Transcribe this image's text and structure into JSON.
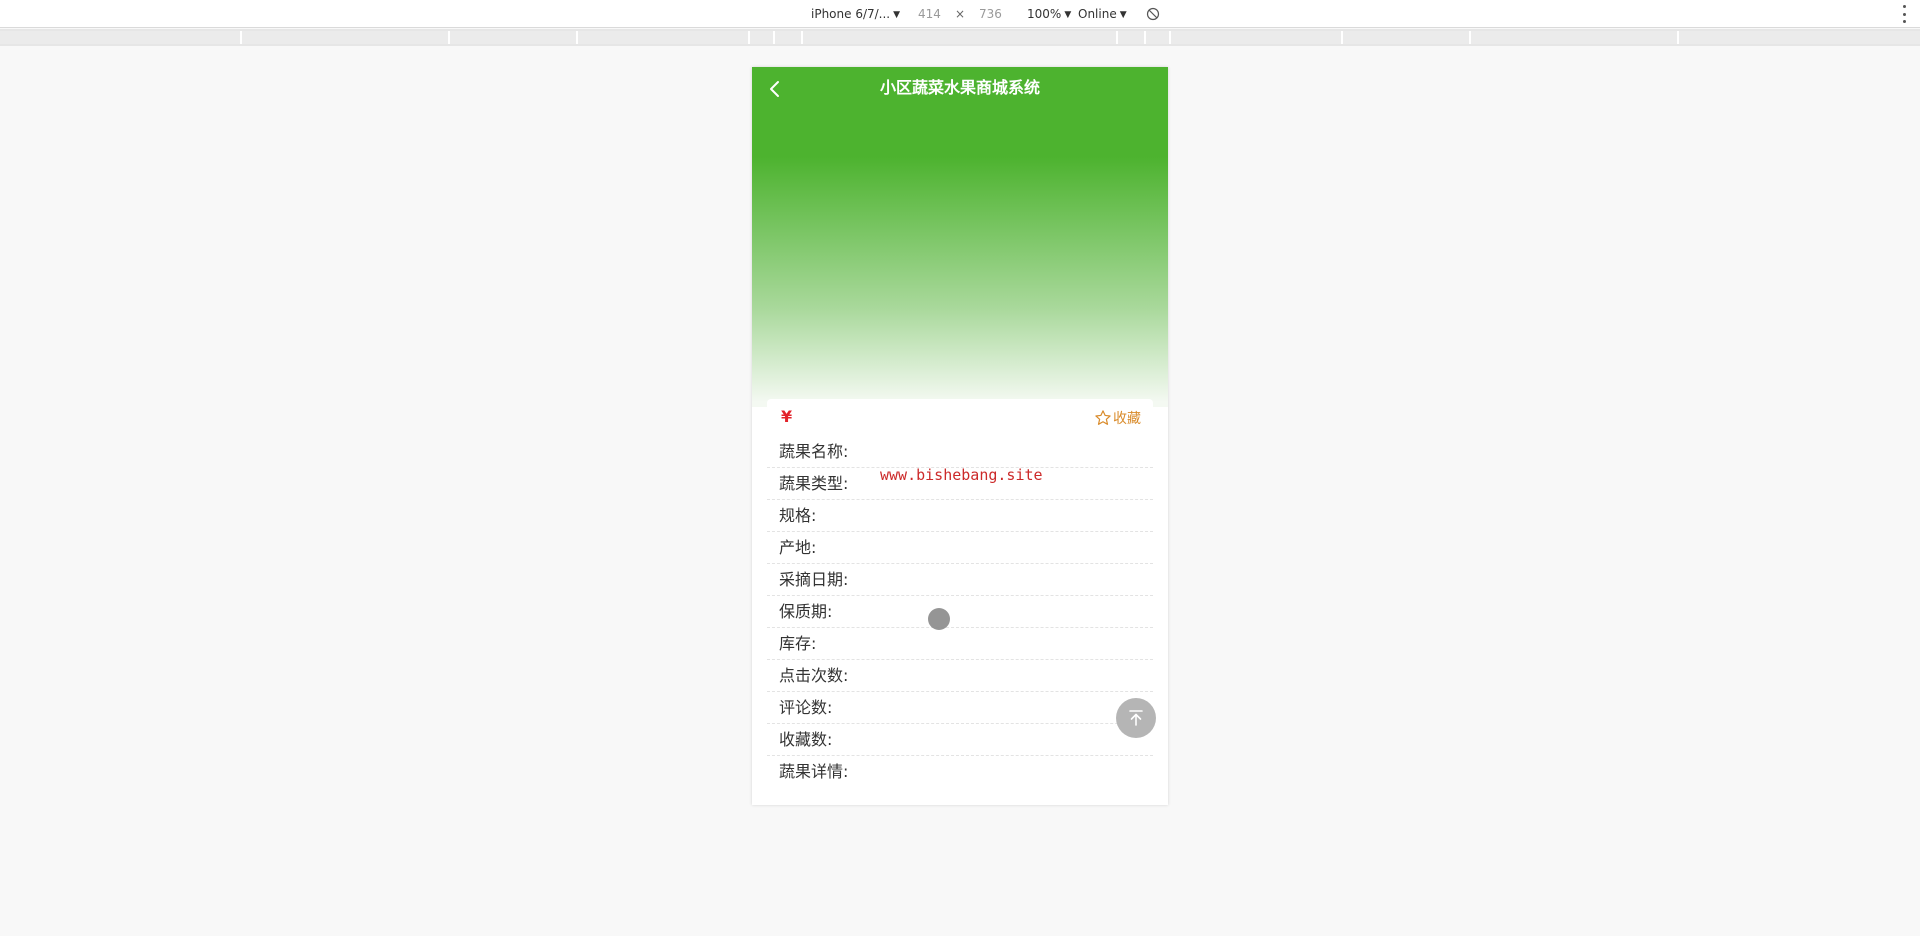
{
  "devtools": {
    "device": "iPhone 6/7/...",
    "width": "414",
    "times": "×",
    "height": "736",
    "zoom": "100%",
    "network": "Online"
  },
  "app": {
    "title": "小区蔬菜水果商城系统"
  },
  "product": {
    "currency": "¥",
    "favorite_label": "收藏",
    "fields": [
      {
        "label": "蔬果名称:"
      },
      {
        "label": "蔬果类型:"
      },
      {
        "label": "规格:"
      },
      {
        "label": "产地:"
      },
      {
        "label": "采摘日期:"
      },
      {
        "label": "保质期:"
      },
      {
        "label": "库存:"
      },
      {
        "label": "点击次数:"
      },
      {
        "label": "评论数:"
      },
      {
        "label": "收藏数:"
      },
      {
        "label": "蔬果详情:"
      }
    ]
  },
  "watermark": "www.bishebang.site",
  "icons": {
    "back": "chevron-left-icon",
    "favorite": "star-outline-icon",
    "back_to_top": "arrow-up-bar-icon",
    "rotate": "rotate-icon",
    "menu": "more-vertical-icon"
  },
  "colors": {
    "header_green": "#4db32f",
    "price_red": "#e2222a",
    "favorite_orange": "#d98b2b"
  }
}
